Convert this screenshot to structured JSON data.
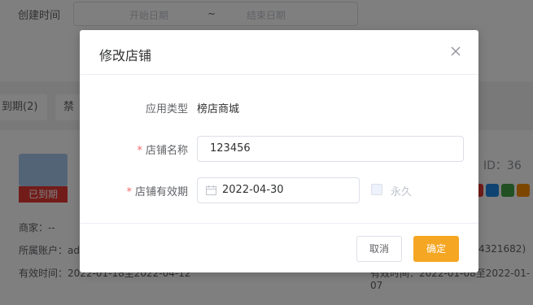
{
  "background": {
    "filter": {
      "created_time_label": "创建时间",
      "start_placeholder": "开始日期",
      "separator": "~",
      "end_placeholder": "结束日期"
    },
    "tabs": [
      {
        "label": "到期(2)"
      },
      {
        "label": "禁"
      }
    ],
    "card_left": {
      "badge": "已到期",
      "merchant": "商家：--",
      "account": "所属账户：ad",
      "valid": "有效时间：2022-01-18至2022-04-12"
    },
    "card_right": {
      "id": "ID：36",
      "account_suffix": "4321682)",
      "valid": "有效时间：2022-01-08至2022-01-07"
    }
  },
  "dialog": {
    "title": "修改店铺",
    "fields": {
      "app_type_label": "应用类型",
      "app_type_value": "榜店商城",
      "name_label": "店铺名称",
      "name_value": "123456",
      "expiry_label": "店铺有效期",
      "expiry_value": "2022-04-30",
      "permanent_label": "永久"
    },
    "buttons": {
      "cancel": "取消",
      "confirm": "确定"
    }
  },
  "colors": {
    "accent": "#f5a623",
    "required": "#f56c6c",
    "expired": "#e53935"
  }
}
